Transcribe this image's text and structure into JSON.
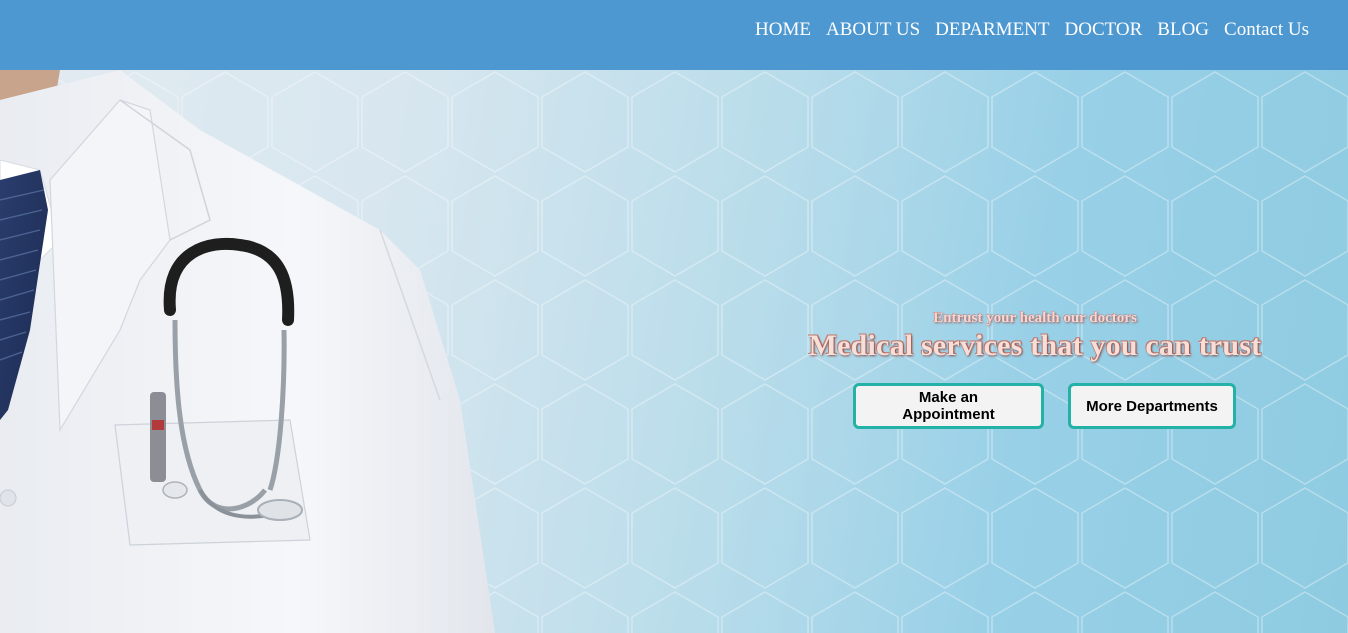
{
  "nav": {
    "items": [
      {
        "label": "HOME"
      },
      {
        "label": "ABOUT US"
      },
      {
        "label": "DEPARMENT"
      },
      {
        "label": "DOCTOR"
      },
      {
        "label": "BLOG"
      },
      {
        "label": "Contact Us"
      }
    ]
  },
  "hero": {
    "subtitle": "Entrust your health our doctors",
    "title": "Medical services that you can trust",
    "buttons": {
      "appointment": "Make an Appointment",
      "departments": "More Departments"
    }
  },
  "colors": {
    "navbar": "#4e98d2",
    "button_border": "#24b2a6",
    "button_bg": "#f3f3f3"
  }
}
